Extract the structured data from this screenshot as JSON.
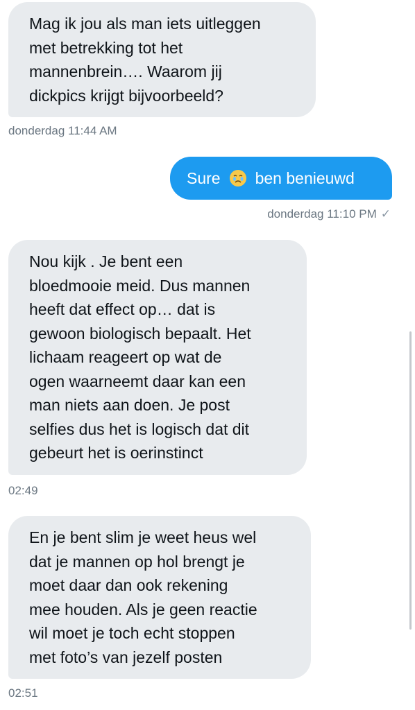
{
  "messages": [
    {
      "text": "Mag ik jou als man iets uitleggen\nmet betrekking tot het\nmannenbrein…. Waarom jij\ndickpics krijgt bijvoorbeeld?",
      "timestamp": "donderdag 11:44 AM"
    },
    {
      "text_before": "Sure",
      "emoji": "face-holding-back-tears",
      "text_after": "ben benieuwd",
      "timestamp": "donderdag 11:10 PM",
      "status": "✓"
    },
    {
      "text": "Nou kijk . Je bent een\nbloedmooie meid. Dus mannen\nheeft dat effect op… dat is\ngewoon biologisch bepaalt. Het\nlichaam reageert op wat de\nogen waarneemt daar kan een\nman niets aan doen. Je post\nselfies dus het is logisch dat dit\ngebeurt het is oerinstinct",
      "timestamp": "02:49"
    },
    {
      "text": "En je bent slim je weet heus wel\ndat je mannen op hol brengt je\nmoet daar dan ook rekening\nmee houden. Als je geen reactie\nwil moet je toch echt stoppen\nmet foto’s van jezelf posten",
      "timestamp": "02:51"
    }
  ],
  "colors": {
    "incoming_bubble": "#e8ebee",
    "outgoing_bubble": "#1d9bf0",
    "timestamp": "#6b7782"
  }
}
